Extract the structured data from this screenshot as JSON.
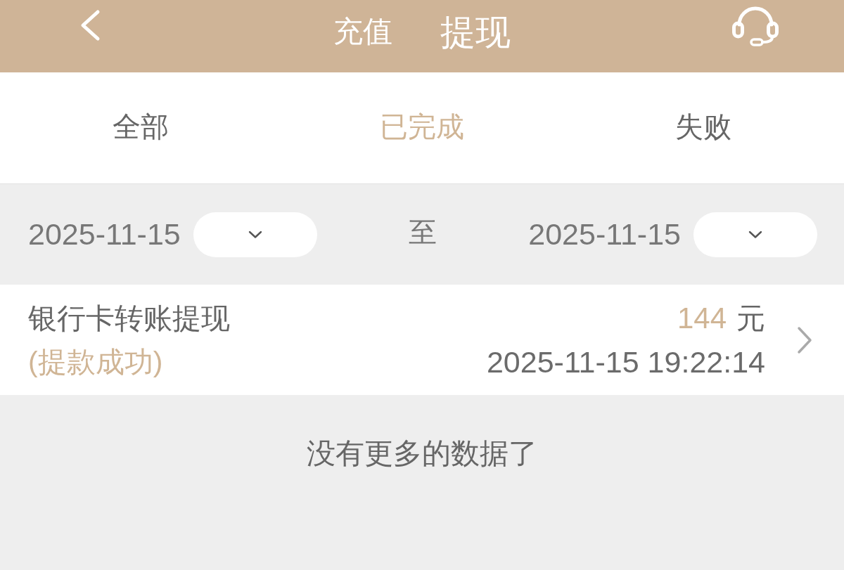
{
  "header": {
    "tabs": [
      {
        "label": "充值",
        "selected": false
      },
      {
        "label": "提现",
        "selected": true
      }
    ]
  },
  "filter_tabs": [
    {
      "label": "全部",
      "selected": false
    },
    {
      "label": "已完成",
      "selected": true
    },
    {
      "label": "失败",
      "selected": false
    }
  ],
  "date_range": {
    "start": "2025-11-15",
    "separator": "至",
    "end": "2025-11-15"
  },
  "records": [
    {
      "title": "银行卡转账提现",
      "status": "(提款成功)",
      "amount": "144",
      "unit": "元",
      "time": "2025-11-15 19:22:14"
    }
  ],
  "footer": "没有更多的数据了"
}
